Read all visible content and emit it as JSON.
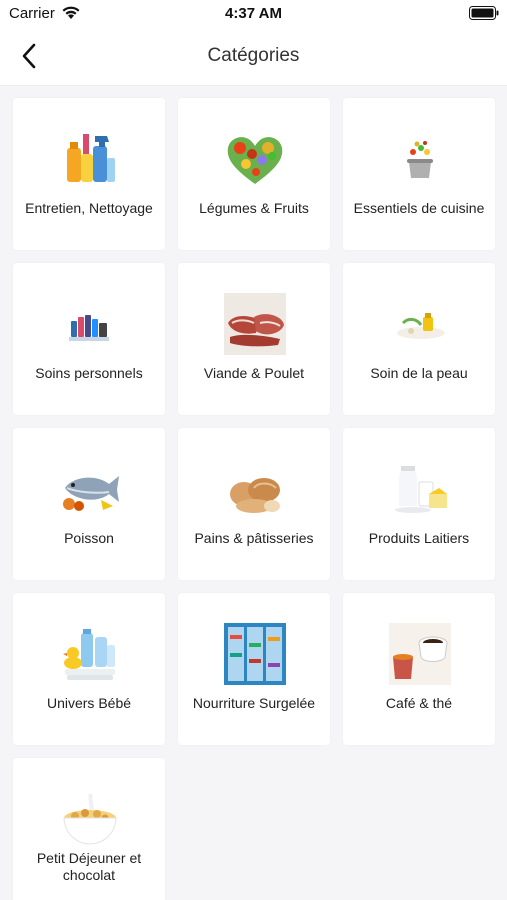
{
  "status_bar": {
    "carrier": "Carrier",
    "time": "4:37 AM"
  },
  "nav": {
    "title": "Catégories"
  },
  "categories": [
    {
      "label": "Entretien, Nettoyage",
      "icon": "cleaning-products-icon"
    },
    {
      "label": "Légumes & Fruits",
      "icon": "fruit-heart-icon"
    },
    {
      "label": "Essentiels de cuisine",
      "icon": "cooking-pot-icon"
    },
    {
      "label": "Soins personnels",
      "icon": "personal-care-icon"
    },
    {
      "label": "Viande & Poulet",
      "icon": "meat-icon"
    },
    {
      "label": "Soin de la peau",
      "icon": "skin-care-icon"
    },
    {
      "label": "Poisson",
      "icon": "fish-icon"
    },
    {
      "label": "Pains & pâtisseries",
      "icon": "bread-icon"
    },
    {
      "label": "Produits Laitiers",
      "icon": "dairy-icon"
    },
    {
      "label": "Univers Bébé",
      "icon": "baby-products-icon"
    },
    {
      "label": "Nourriture Surgelée",
      "icon": "freezer-icon"
    },
    {
      "label": "Café & thé",
      "icon": "coffee-tea-icon"
    },
    {
      "label": "Petit Déjeuner et chocolat",
      "icon": "cereal-bowl-icon"
    }
  ]
}
